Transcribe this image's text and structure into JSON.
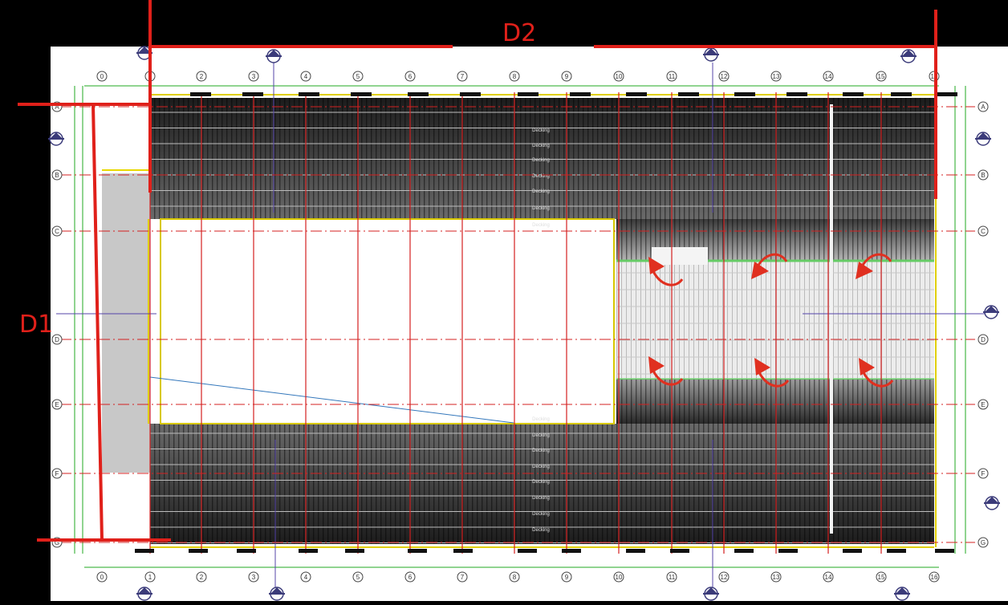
{
  "dimensions": {
    "horizontal_label": "D2",
    "vertical_label": "D1"
  },
  "column_gridlines": [
    "0",
    "1",
    "2",
    "3",
    "4",
    "5",
    "6",
    "7",
    "8",
    "9",
    "10",
    "11",
    "12",
    "13",
    "14",
    "15",
    "16"
  ],
  "row_gridlines": [
    "A",
    "B",
    "C",
    "D",
    "E",
    "F",
    "G"
  ],
  "deck_tag": "Decking",
  "colors": {
    "dimension_red": "#e0201a",
    "gridline_red": "#d42020",
    "drawing_background": "#ffffff",
    "roof_dark": "#333333",
    "roof_light": "#e6e6e6",
    "arrow": "#e03020"
  }
}
